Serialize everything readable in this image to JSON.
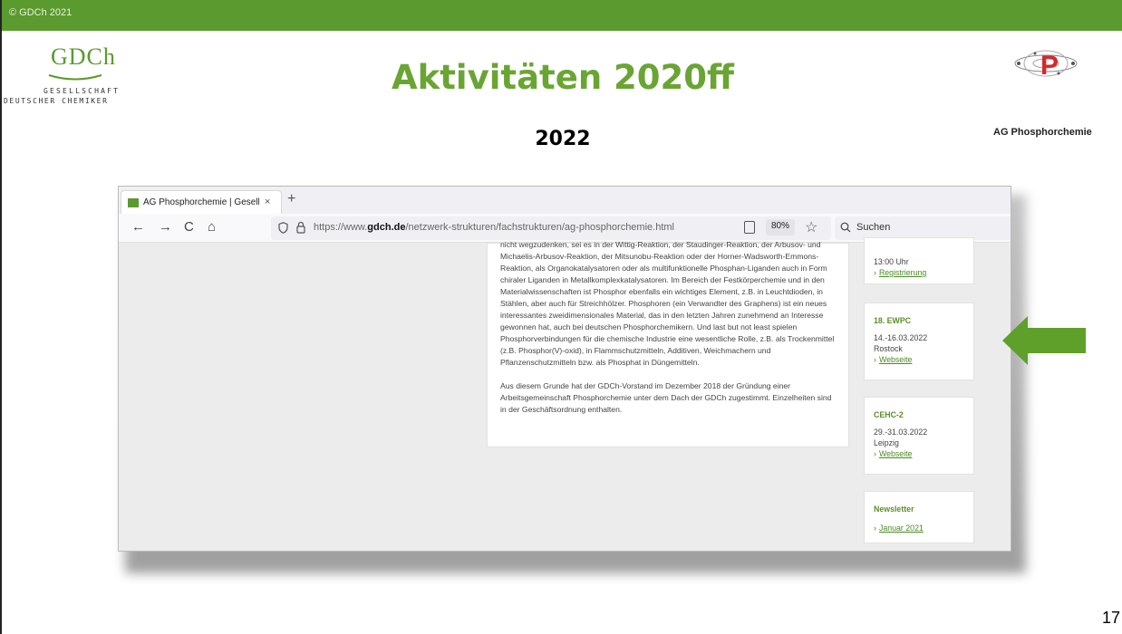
{
  "slide": {
    "copyright": "© GDCh 2021",
    "title": "Aktivitäten 2020ff",
    "year": "2022",
    "page_number": "17"
  },
  "gdch_logo": {
    "wordmark": "GDCh",
    "line1": "Gesellschaft",
    "line2": "Deutscher Chemiker"
  },
  "ag_logo": {
    "label": "AG Phosphorchemie"
  },
  "browser": {
    "tab_title": "AG Phosphorchemie | Gesellsch",
    "tab_close": "×",
    "new_tab": "+",
    "nav": {
      "back": "←",
      "forward": "→",
      "reload": "C",
      "home": "⌂"
    },
    "url_prefix": "https://www.",
    "url_domain": "gdch.de",
    "url_path": "/netzwerk-strukturen/fachstrukturen/ag-phosphorchemie.html",
    "zoom": "80%",
    "search_placeholder": "Suchen"
  },
  "article": {
    "paragraph1": "nicht wegzudenken, sei es in der Wittig-Reaktion, der Staudinger-Reaktion, der Arbusov- und Michaelis-Arbusov-Reaktion, der Mitsunobu-Reaktion oder der Horner-Wadsworth-Emmons-Reaktion, als Organokatalysatoren oder als multifunktionelle Phosphan-Liganden auch in Form chiraler Liganden in Metallkomplexkatalysatoren. Im Bereich der Festkörperchemie und in den Materialwissenschaften ist Phosphor ebenfalls ein wichtiges Element, z.B. in Leuchtdioden, in Stählen, aber auch für Streichhölzer. Phosphoren (ein Verwandter des Graphens) ist ein neues interessantes zweidimensionales Material, das in den letzten Jahren zunehmend an Interesse gewonnen hat, auch bei deutschen Phosphorchemikern. Und last but not least spielen Phosphorverbindungen für die chemische Industrie eine wesentliche Rolle, z.B. als Trockenmittel (z.B. Phosphor(V)-oxid), in Flammschutzmitteln, Additiven, Weichmachern und Pflanzenschutzmitteln bzw. als Phosphat in Düngemitteln.",
    "paragraph2": "Aus diesem Grunde hat der GDCh-Vorstand im Dezember 2018 der Gründung einer Arbeitsgemeinschaft Phosphorchemie unter dem Dach der GDCh zugestimmt. Einzelheiten sind in der Geschäftsordnung enthalten."
  },
  "sidebar": {
    "card0": {
      "time": "13:00 Uhr",
      "link": "Registrierung"
    },
    "card1": {
      "title": "18. EWPC",
      "dates": "14.-16.03.2022",
      "place": "Rostock",
      "link": "Webseite"
    },
    "card2": {
      "title": "CEHC-2",
      "dates": "29.-31.03.2022",
      "place": "Leipzig",
      "link": "Webseite"
    },
    "card3": {
      "title": "Newsletter",
      "link": "Januar 2021"
    },
    "chevron": "›"
  },
  "colors": {
    "brand_green": "#5a9a2e",
    "title_green": "#6aa533",
    "arrow_green": "#5fa02a",
    "ag_logo_red": "#d42a2a"
  }
}
